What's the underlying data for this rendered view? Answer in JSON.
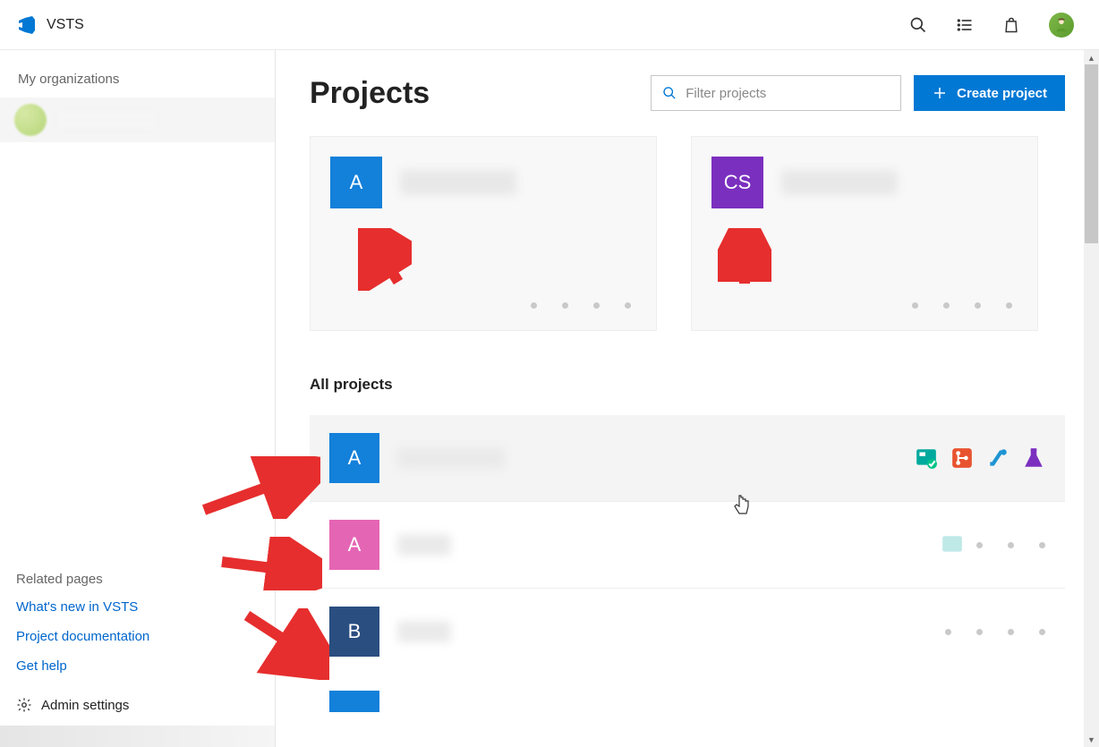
{
  "header": {
    "product_name": "VSTS"
  },
  "sidebar": {
    "orgs_label": "My organizations",
    "related_label": "Related pages",
    "links": [
      {
        "label": "What's new in VSTS"
      },
      {
        "label": "Project documentation"
      },
      {
        "label": "Get help"
      }
    ],
    "admin_label": "Admin settings"
  },
  "main": {
    "title": "Projects",
    "filter_placeholder": "Filter projects",
    "create_label": "Create project",
    "featured_projects": [
      {
        "initials": "A",
        "tile_color": "blue"
      },
      {
        "initials": "CS",
        "tile_color": "purple"
      }
    ],
    "all_projects_label": "All projects",
    "all_projects": [
      {
        "initials": "A",
        "tile_color": "blue",
        "hovered": true,
        "show_service_icons": true
      },
      {
        "initials": "A",
        "tile_color": "pink",
        "hovered": false,
        "show_service_icons": false
      },
      {
        "initials": "B",
        "tile_color": "navy",
        "hovered": false,
        "show_service_icons": false
      }
    ]
  }
}
